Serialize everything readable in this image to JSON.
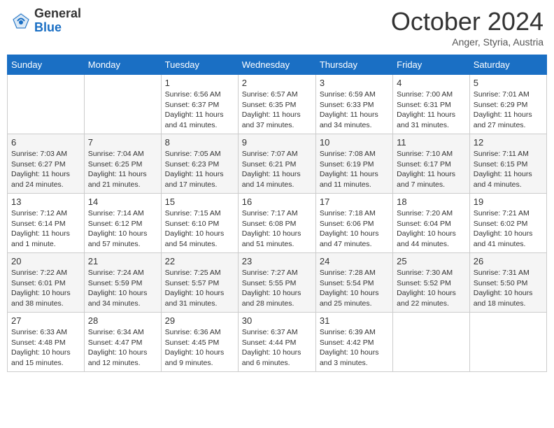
{
  "header": {
    "logo_general": "General",
    "logo_blue": "Blue",
    "month_title": "October 2024",
    "location": "Anger, Styria, Austria"
  },
  "days_of_week": [
    "Sunday",
    "Monday",
    "Tuesday",
    "Wednesday",
    "Thursday",
    "Friday",
    "Saturday"
  ],
  "weeks": [
    [
      {
        "day": "",
        "info": ""
      },
      {
        "day": "",
        "info": ""
      },
      {
        "day": "1",
        "info": "Sunrise: 6:56 AM\nSunset: 6:37 PM\nDaylight: 11 hours and 41 minutes."
      },
      {
        "day": "2",
        "info": "Sunrise: 6:57 AM\nSunset: 6:35 PM\nDaylight: 11 hours and 37 minutes."
      },
      {
        "day": "3",
        "info": "Sunrise: 6:59 AM\nSunset: 6:33 PM\nDaylight: 11 hours and 34 minutes."
      },
      {
        "day": "4",
        "info": "Sunrise: 7:00 AM\nSunset: 6:31 PM\nDaylight: 11 hours and 31 minutes."
      },
      {
        "day": "5",
        "info": "Sunrise: 7:01 AM\nSunset: 6:29 PM\nDaylight: 11 hours and 27 minutes."
      }
    ],
    [
      {
        "day": "6",
        "info": "Sunrise: 7:03 AM\nSunset: 6:27 PM\nDaylight: 11 hours and 24 minutes."
      },
      {
        "day": "7",
        "info": "Sunrise: 7:04 AM\nSunset: 6:25 PM\nDaylight: 11 hours and 21 minutes."
      },
      {
        "day": "8",
        "info": "Sunrise: 7:05 AM\nSunset: 6:23 PM\nDaylight: 11 hours and 17 minutes."
      },
      {
        "day": "9",
        "info": "Sunrise: 7:07 AM\nSunset: 6:21 PM\nDaylight: 11 hours and 14 minutes."
      },
      {
        "day": "10",
        "info": "Sunrise: 7:08 AM\nSunset: 6:19 PM\nDaylight: 11 hours and 11 minutes."
      },
      {
        "day": "11",
        "info": "Sunrise: 7:10 AM\nSunset: 6:17 PM\nDaylight: 11 hours and 7 minutes."
      },
      {
        "day": "12",
        "info": "Sunrise: 7:11 AM\nSunset: 6:15 PM\nDaylight: 11 hours and 4 minutes."
      }
    ],
    [
      {
        "day": "13",
        "info": "Sunrise: 7:12 AM\nSunset: 6:14 PM\nDaylight: 11 hours and 1 minute."
      },
      {
        "day": "14",
        "info": "Sunrise: 7:14 AM\nSunset: 6:12 PM\nDaylight: 10 hours and 57 minutes."
      },
      {
        "day": "15",
        "info": "Sunrise: 7:15 AM\nSunset: 6:10 PM\nDaylight: 10 hours and 54 minutes."
      },
      {
        "day": "16",
        "info": "Sunrise: 7:17 AM\nSunset: 6:08 PM\nDaylight: 10 hours and 51 minutes."
      },
      {
        "day": "17",
        "info": "Sunrise: 7:18 AM\nSunset: 6:06 PM\nDaylight: 10 hours and 47 minutes."
      },
      {
        "day": "18",
        "info": "Sunrise: 7:20 AM\nSunset: 6:04 PM\nDaylight: 10 hours and 44 minutes."
      },
      {
        "day": "19",
        "info": "Sunrise: 7:21 AM\nSunset: 6:02 PM\nDaylight: 10 hours and 41 minutes."
      }
    ],
    [
      {
        "day": "20",
        "info": "Sunrise: 7:22 AM\nSunset: 6:01 PM\nDaylight: 10 hours and 38 minutes."
      },
      {
        "day": "21",
        "info": "Sunrise: 7:24 AM\nSunset: 5:59 PM\nDaylight: 10 hours and 34 minutes."
      },
      {
        "day": "22",
        "info": "Sunrise: 7:25 AM\nSunset: 5:57 PM\nDaylight: 10 hours and 31 minutes."
      },
      {
        "day": "23",
        "info": "Sunrise: 7:27 AM\nSunset: 5:55 PM\nDaylight: 10 hours and 28 minutes."
      },
      {
        "day": "24",
        "info": "Sunrise: 7:28 AM\nSunset: 5:54 PM\nDaylight: 10 hours and 25 minutes."
      },
      {
        "day": "25",
        "info": "Sunrise: 7:30 AM\nSunset: 5:52 PM\nDaylight: 10 hours and 22 minutes."
      },
      {
        "day": "26",
        "info": "Sunrise: 7:31 AM\nSunset: 5:50 PM\nDaylight: 10 hours and 18 minutes."
      }
    ],
    [
      {
        "day": "27",
        "info": "Sunrise: 6:33 AM\nSunset: 4:48 PM\nDaylight: 10 hours and 15 minutes."
      },
      {
        "day": "28",
        "info": "Sunrise: 6:34 AM\nSunset: 4:47 PM\nDaylight: 10 hours and 12 minutes."
      },
      {
        "day": "29",
        "info": "Sunrise: 6:36 AM\nSunset: 4:45 PM\nDaylight: 10 hours and 9 minutes."
      },
      {
        "day": "30",
        "info": "Sunrise: 6:37 AM\nSunset: 4:44 PM\nDaylight: 10 hours and 6 minutes."
      },
      {
        "day": "31",
        "info": "Sunrise: 6:39 AM\nSunset: 4:42 PM\nDaylight: 10 hours and 3 minutes."
      },
      {
        "day": "",
        "info": ""
      },
      {
        "day": "",
        "info": ""
      }
    ]
  ]
}
